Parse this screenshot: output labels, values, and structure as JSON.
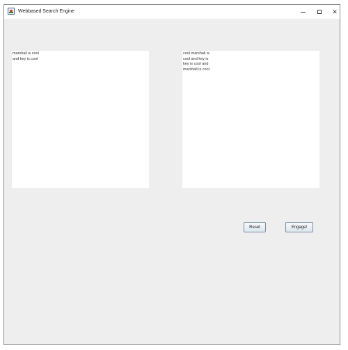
{
  "window": {
    "title": "Webbased Search Engine",
    "controls": {
      "minimize": "minimize-icon",
      "maximize": "maximize-icon",
      "close": "✕"
    }
  },
  "input_area": {
    "value": "marshall is cool\nand key is cool"
  },
  "output_area": {
    "value": "cool marshall is\ncool and key is\nkey is cool and\nmarshall is cool"
  },
  "buttons": {
    "reset_label": "Reset",
    "engage_label": "Engage!"
  },
  "colors": {
    "window_bg": "#eeeeee",
    "text_area_bg": "#ffffff",
    "titlebar_bg": "#ffffff"
  }
}
